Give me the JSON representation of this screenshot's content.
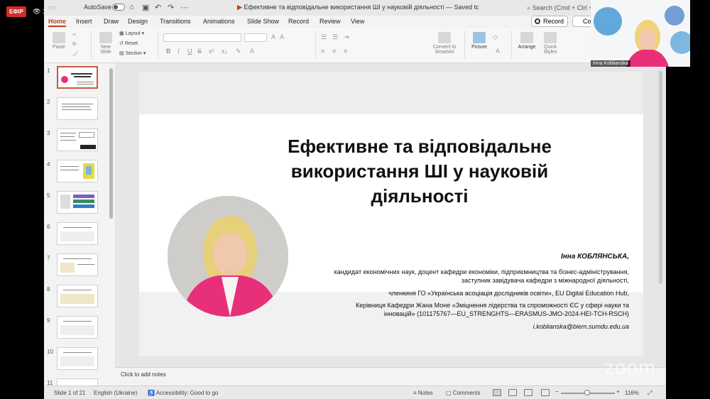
{
  "overlay": {
    "live_badge": "ЕФІР",
    "viewers_count": "139",
    "zoom_watermark": "zoom",
    "camera_label": "Irina Koblianska"
  },
  "titlebar": {
    "autosave_label": "AutoSave",
    "doc_title": "Ефективне та відповідальне використання ШІ у науковій діяльності — Saved to my Mac",
    "search_placeholder": "Search (Cmd + Ctrl + U)"
  },
  "tabs": [
    "Home",
    "Insert",
    "Draw",
    "Design",
    "Transitions",
    "Animations",
    "Slide Show",
    "Record",
    "Review",
    "View"
  ],
  "active_tab": "Home",
  "record_button": "Record",
  "co_button": "Co",
  "ribbon": {
    "paste": "Paste",
    "new_slide": "New Slide",
    "layout": "Layout",
    "reset": "Reset",
    "section": "Section",
    "convert": "Convert to SmartArt",
    "picture": "Picture",
    "arrange": "Arrange",
    "quick_styles": "Quick Styles"
  },
  "thumbnails": [
    "1",
    "2",
    "3",
    "4",
    "5",
    "6",
    "7",
    "8",
    "9",
    "10",
    "11"
  ],
  "slide": {
    "title": "Ефективне та відповідальне використання ШІ у науковій діяльності",
    "author_name": "Інна КОБЛЯНСЬКА,",
    "lines": [
      "кандидат економічних наук, доцент кафедри економіки, підприємництва та бізнес-адміністрування,",
      "заступник завідувача кафедри з міжнародної діяльності,",
      "членкиня ГО «Українська асоціація дослідників освіти», EU Digital Education Hub,",
      "Керівниця Кафедри Жана Моне «Зміцнення лідерства та спроможності ЄС у сфері науки та",
      "інновацій» (101175767—EU_STRENGHTS—ERASMUS-JMO-2024-HEI-TCH-RSCH)"
    ],
    "email": "i.koblianska@biem.sumdu.edu.ua"
  },
  "notes_placeholder": "Click to add notes",
  "statusbar": {
    "slide_of": "Slide 1 of 21",
    "language": "English (Ukraine)",
    "accessibility": "Accessibility: Good to go",
    "notes": "Notes",
    "comments": "Comments",
    "zoom": "116%"
  },
  "colors": {
    "accent": "#c43e1c",
    "live_badge": "#d12b2b",
    "jacket": "#e8307a"
  }
}
